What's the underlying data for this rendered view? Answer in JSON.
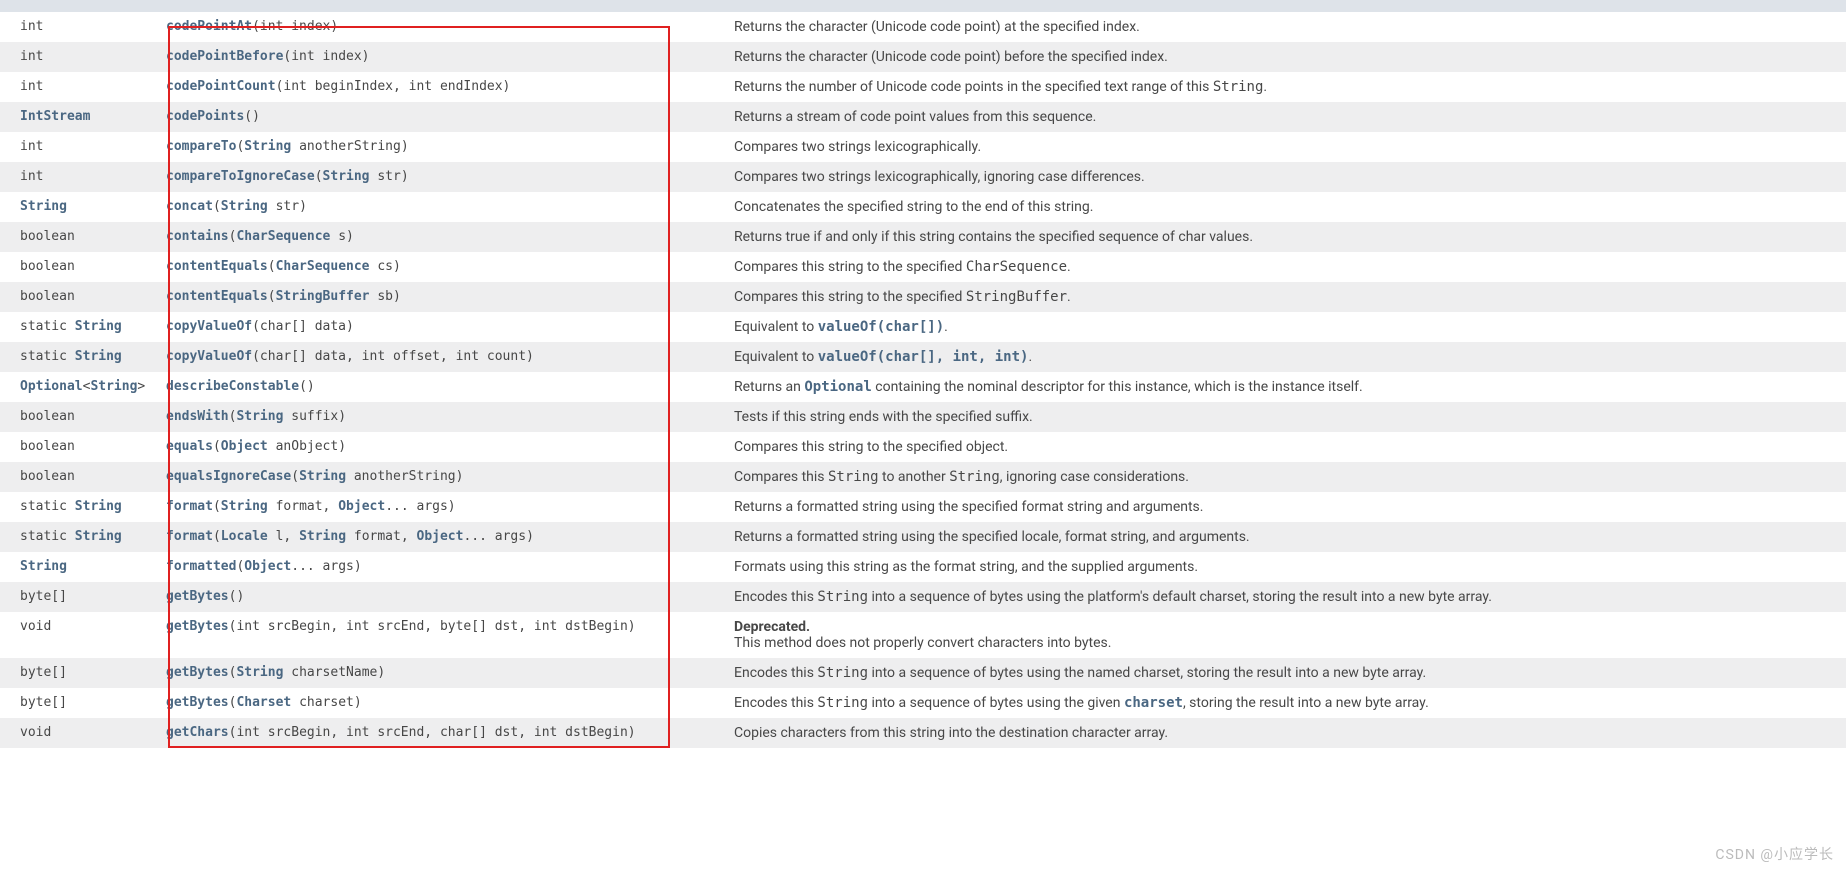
{
  "watermark": "CSDN @小应学长",
  "rows": [
    {
      "type": [
        {
          "t": "plain",
          "v": "int"
        }
      ],
      "sig": [
        {
          "t": "link",
          "v": "codePointAt"
        },
        {
          "t": "plain",
          "v": "(int index)"
        }
      ],
      "desc": [
        {
          "t": "text",
          "v": "Returns the character (Unicode code point) at the specified index."
        }
      ]
    },
    {
      "type": [
        {
          "t": "plain",
          "v": "int"
        }
      ],
      "sig": [
        {
          "t": "link",
          "v": "codePointBefore"
        },
        {
          "t": "plain",
          "v": "(int index)"
        }
      ],
      "desc": [
        {
          "t": "text",
          "v": "Returns the character (Unicode code point) before the specified index."
        }
      ]
    },
    {
      "type": [
        {
          "t": "plain",
          "v": "int"
        }
      ],
      "sig": [
        {
          "t": "link",
          "v": "codePointCount"
        },
        {
          "t": "plain",
          "v": "(int beginIndex, int endIndex)"
        }
      ],
      "desc": [
        {
          "t": "text",
          "v": "Returns the number of Unicode code points in the specified text range of this "
        },
        {
          "t": "code",
          "v": "String"
        },
        {
          "t": "text",
          "v": "."
        }
      ]
    },
    {
      "type": [
        {
          "t": "link",
          "v": "IntStream"
        }
      ],
      "sig": [
        {
          "t": "link",
          "v": "codePoints"
        },
        {
          "t": "plain",
          "v": "()"
        }
      ],
      "desc": [
        {
          "t": "text",
          "v": "Returns a stream of code point values from this sequence."
        }
      ]
    },
    {
      "type": [
        {
          "t": "plain",
          "v": "int"
        }
      ],
      "sig": [
        {
          "t": "link",
          "v": "compareTo"
        },
        {
          "t": "plain",
          "v": "("
        },
        {
          "t": "link",
          "v": "String"
        },
        {
          "t": "plain",
          "v": " anotherString)"
        }
      ],
      "desc": [
        {
          "t": "text",
          "v": "Compares two strings lexicographically."
        }
      ]
    },
    {
      "type": [
        {
          "t": "plain",
          "v": "int"
        }
      ],
      "sig": [
        {
          "t": "link",
          "v": "compareToIgnoreCase"
        },
        {
          "t": "plain",
          "v": "("
        },
        {
          "t": "link",
          "v": "String"
        },
        {
          "t": "plain",
          "v": " str)"
        }
      ],
      "desc": [
        {
          "t": "text",
          "v": "Compares two strings lexicographically, ignoring case differences."
        }
      ]
    },
    {
      "type": [
        {
          "t": "link",
          "v": "String"
        }
      ],
      "sig": [
        {
          "t": "link",
          "v": "concat"
        },
        {
          "t": "plain",
          "v": "("
        },
        {
          "t": "link",
          "v": "String"
        },
        {
          "t": "plain",
          "v": " str)"
        }
      ],
      "desc": [
        {
          "t": "text",
          "v": "Concatenates the specified string to the end of this string."
        }
      ]
    },
    {
      "type": [
        {
          "t": "plain",
          "v": "boolean"
        }
      ],
      "sig": [
        {
          "t": "link",
          "v": "contains"
        },
        {
          "t": "plain",
          "v": "("
        },
        {
          "t": "link",
          "v": "CharSequence"
        },
        {
          "t": "plain",
          "v": " s)"
        }
      ],
      "desc": [
        {
          "t": "text",
          "v": "Returns true if and only if this string contains the specified sequence of char values."
        }
      ]
    },
    {
      "type": [
        {
          "t": "plain",
          "v": "boolean"
        }
      ],
      "sig": [
        {
          "t": "link",
          "v": "contentEquals"
        },
        {
          "t": "plain",
          "v": "("
        },
        {
          "t": "link",
          "v": "CharSequence"
        },
        {
          "t": "plain",
          "v": " cs)"
        }
      ],
      "desc": [
        {
          "t": "text",
          "v": "Compares this string to the specified "
        },
        {
          "t": "code",
          "v": "CharSequence"
        },
        {
          "t": "text",
          "v": "."
        }
      ]
    },
    {
      "type": [
        {
          "t": "plain",
          "v": "boolean"
        }
      ],
      "sig": [
        {
          "t": "link",
          "v": "contentEquals"
        },
        {
          "t": "plain",
          "v": "("
        },
        {
          "t": "link",
          "v": "StringBuffer"
        },
        {
          "t": "plain",
          "v": " sb)"
        }
      ],
      "desc": [
        {
          "t": "text",
          "v": "Compares this string to the specified "
        },
        {
          "t": "code",
          "v": "StringBuffer"
        },
        {
          "t": "text",
          "v": "."
        }
      ]
    },
    {
      "type": [
        {
          "t": "plain",
          "v": "static "
        },
        {
          "t": "link",
          "v": "String"
        }
      ],
      "sig": [
        {
          "t": "link",
          "v": "copyValueOf"
        },
        {
          "t": "plain",
          "v": "(char[] data)"
        }
      ],
      "desc": [
        {
          "t": "text",
          "v": "Equivalent to "
        },
        {
          "t": "codelink",
          "v": "valueOf(char[])"
        },
        {
          "t": "text",
          "v": "."
        }
      ]
    },
    {
      "type": [
        {
          "t": "plain",
          "v": "static "
        },
        {
          "t": "link",
          "v": "String"
        }
      ],
      "sig": [
        {
          "t": "link",
          "v": "copyValueOf"
        },
        {
          "t": "plain",
          "v": "(char[] data, int offset, int count)"
        }
      ],
      "desc": [
        {
          "t": "text",
          "v": "Equivalent to "
        },
        {
          "t": "codelink",
          "v": "valueOf(char[], int, int)"
        },
        {
          "t": "text",
          "v": "."
        }
      ]
    },
    {
      "type": [
        {
          "t": "link",
          "v": "Optional"
        },
        {
          "t": "plain",
          "v": "<"
        },
        {
          "t": "link",
          "v": "String"
        },
        {
          "t": "plain",
          "v": ">"
        }
      ],
      "sig": [
        {
          "t": "link",
          "v": "describeConstable"
        },
        {
          "t": "plain",
          "v": "()"
        }
      ],
      "desc": [
        {
          "t": "text",
          "v": "Returns an "
        },
        {
          "t": "codelink",
          "v": "Optional"
        },
        {
          "t": "text",
          "v": " containing the nominal descriptor for this instance, which is the instance itself."
        }
      ]
    },
    {
      "type": [
        {
          "t": "plain",
          "v": "boolean"
        }
      ],
      "sig": [
        {
          "t": "link",
          "v": "endsWith"
        },
        {
          "t": "plain",
          "v": "("
        },
        {
          "t": "link",
          "v": "String"
        },
        {
          "t": "plain",
          "v": " suffix)"
        }
      ],
      "desc": [
        {
          "t": "text",
          "v": "Tests if this string ends with the specified suffix."
        }
      ]
    },
    {
      "type": [
        {
          "t": "plain",
          "v": "boolean"
        }
      ],
      "sig": [
        {
          "t": "link",
          "v": "equals"
        },
        {
          "t": "plain",
          "v": "("
        },
        {
          "t": "link",
          "v": "Object"
        },
        {
          "t": "plain",
          "v": " anObject)"
        }
      ],
      "desc": [
        {
          "t": "text",
          "v": "Compares this string to the specified object."
        }
      ]
    },
    {
      "type": [
        {
          "t": "plain",
          "v": "boolean"
        }
      ],
      "sig": [
        {
          "t": "link",
          "v": "equalsIgnoreCase"
        },
        {
          "t": "plain",
          "v": "("
        },
        {
          "t": "link",
          "v": "String"
        },
        {
          "t": "plain",
          "v": " anotherString)"
        }
      ],
      "desc": [
        {
          "t": "text",
          "v": "Compares this "
        },
        {
          "t": "code",
          "v": "String"
        },
        {
          "t": "text",
          "v": " to another "
        },
        {
          "t": "code",
          "v": "String"
        },
        {
          "t": "text",
          "v": ", ignoring case considerations."
        }
      ]
    },
    {
      "type": [
        {
          "t": "plain",
          "v": "static "
        },
        {
          "t": "link",
          "v": "String"
        }
      ],
      "sig": [
        {
          "t": "link",
          "v": "format"
        },
        {
          "t": "plain",
          "v": "("
        },
        {
          "t": "link",
          "v": "String"
        },
        {
          "t": "plain",
          "v": " format, "
        },
        {
          "t": "link",
          "v": "Object"
        },
        {
          "t": "plain",
          "v": "... args)"
        }
      ],
      "desc": [
        {
          "t": "text",
          "v": "Returns a formatted string using the specified format string and arguments."
        }
      ]
    },
    {
      "type": [
        {
          "t": "plain",
          "v": "static "
        },
        {
          "t": "link",
          "v": "String"
        }
      ],
      "sig": [
        {
          "t": "link",
          "v": "format"
        },
        {
          "t": "plain",
          "v": "("
        },
        {
          "t": "link",
          "v": "Locale"
        },
        {
          "t": "plain",
          "v": " l, "
        },
        {
          "t": "link",
          "v": "String"
        },
        {
          "t": "plain",
          "v": " format, "
        },
        {
          "t": "link",
          "v": "Object"
        },
        {
          "t": "plain",
          "v": "... args)"
        }
      ],
      "desc": [
        {
          "t": "text",
          "v": "Returns a formatted string using the specified locale, format string, and arguments."
        }
      ]
    },
    {
      "type": [
        {
          "t": "link",
          "v": "String"
        }
      ],
      "sig": [
        {
          "t": "link",
          "v": "formatted"
        },
        {
          "t": "plain",
          "v": "("
        },
        {
          "t": "link",
          "v": "Object"
        },
        {
          "t": "plain",
          "v": "... args)"
        }
      ],
      "desc": [
        {
          "t": "text",
          "v": "Formats using this string as the format string, and the supplied arguments."
        }
      ]
    },
    {
      "type": [
        {
          "t": "plain",
          "v": "byte[]"
        }
      ],
      "sig": [
        {
          "t": "link",
          "v": "getBytes"
        },
        {
          "t": "plain",
          "v": "()"
        }
      ],
      "desc": [
        {
          "t": "text",
          "v": "Encodes this "
        },
        {
          "t": "code",
          "v": "String"
        },
        {
          "t": "text",
          "v": " into a sequence of bytes using the platform's default charset, storing the result into a new byte array."
        }
      ]
    },
    {
      "type": [
        {
          "t": "plain",
          "v": "void"
        }
      ],
      "sig": [
        {
          "t": "link",
          "v": "getBytes"
        },
        {
          "t": "plain",
          "v": "(int srcBegin, int srcEnd, byte[] dst, int dstBegin)"
        }
      ],
      "desc": [
        {
          "t": "dep",
          "v": "Deprecated."
        },
        {
          "t": "br",
          "v": ""
        },
        {
          "t": "text",
          "v": "This method does not properly convert characters into bytes."
        }
      ]
    },
    {
      "type": [
        {
          "t": "plain",
          "v": "byte[]"
        }
      ],
      "sig": [
        {
          "t": "link",
          "v": "getBytes"
        },
        {
          "t": "plain",
          "v": "("
        },
        {
          "t": "link",
          "v": "String"
        },
        {
          "t": "plain",
          "v": " charsetName)"
        }
      ],
      "desc": [
        {
          "t": "text",
          "v": "Encodes this "
        },
        {
          "t": "code",
          "v": "String"
        },
        {
          "t": "text",
          "v": " into a sequence of bytes using the named charset, storing the result into a new byte array."
        }
      ]
    },
    {
      "type": [
        {
          "t": "plain",
          "v": "byte[]"
        }
      ],
      "sig": [
        {
          "t": "link",
          "v": "getBytes"
        },
        {
          "t": "plain",
          "v": "("
        },
        {
          "t": "link",
          "v": "Charset"
        },
        {
          "t": "plain",
          "v": " charset)"
        }
      ],
      "desc": [
        {
          "t": "text",
          "v": "Encodes this "
        },
        {
          "t": "code",
          "v": "String"
        },
        {
          "t": "text",
          "v": " into a sequence of bytes using the given "
        },
        {
          "t": "codelink",
          "v": "charset"
        },
        {
          "t": "text",
          "v": ", storing the result into a new byte array."
        }
      ]
    },
    {
      "type": [
        {
          "t": "plain",
          "v": "void"
        }
      ],
      "sig": [
        {
          "t": "link",
          "v": "getChars"
        },
        {
          "t": "plain",
          "v": "(int srcBegin, int srcEnd, char[] dst, int dstBegin)"
        }
      ],
      "desc": [
        {
          "t": "text",
          "v": "Copies characters from this string into the destination character array."
        }
      ]
    }
  ]
}
